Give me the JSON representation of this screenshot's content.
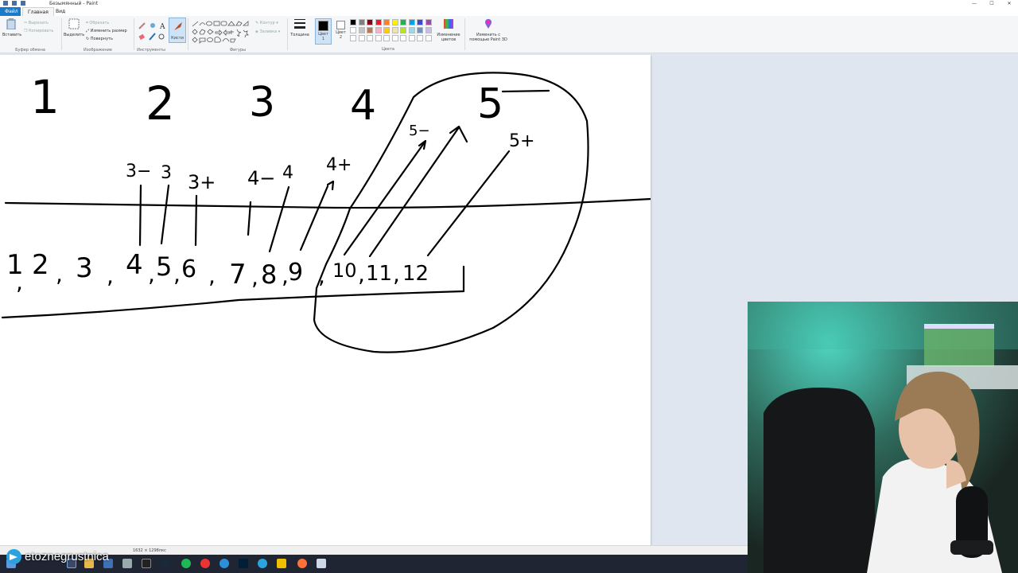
{
  "window": {
    "title": "Безымянный - Paint",
    "controls": [
      "—",
      "☐",
      "✕"
    ]
  },
  "tabs": {
    "file": "Файл",
    "home": "Главная",
    "view": "Вид"
  },
  "ribbon": {
    "clipboard": {
      "paste": "Вставить",
      "cut": "Вырезать",
      "copy": "Копировать",
      "label": "Буфер обмена"
    },
    "image": {
      "select": "Выделить",
      "crop": "Обрезать",
      "resize": "Изменить размер",
      "rotate": "Повернуть",
      "label": "Изображение"
    },
    "tools": {
      "label": "Инструменты"
    },
    "brushes": {
      "label": "Кисти"
    },
    "shapes": {
      "outline": "Контур",
      "fill": "Заливка",
      "label": "Фигуры"
    },
    "size": {
      "label": "Толщина"
    },
    "color1": {
      "label": "Цвет",
      "num": "1"
    },
    "color2": {
      "label": "Цвет",
      "num": "2"
    },
    "colors": {
      "label": "Цвета",
      "edit": "Изменение цветов",
      "palette": [
        "#000000",
        "#7f7f7f",
        "#880015",
        "#ed1c24",
        "#ff7f27",
        "#fff200",
        "#22b14c",
        "#00a2e8",
        "#3f48cc",
        "#a349a4",
        "#ffffff",
        "#c3c3c3",
        "#b97a57",
        "#ffaec9",
        "#ffc90e",
        "#efe4b0",
        "#b5e61d",
        "#99d9ea",
        "#7092be",
        "#c8bfe7"
      ]
    },
    "paint3d": {
      "label": "Изменить с помощью Paint 3D"
    }
  },
  "canvas_text": {
    "grades": [
      "1",
      "2",
      "3",
      "4",
      "5"
    ],
    "sub_grades": [
      "3−",
      "3",
      "3+",
      "4−",
      "4",
      "4+",
      "5−",
      "5+"
    ],
    "scale": [
      "1",
      "2",
      "3",
      "4",
      "5",
      "6",
      "7",
      "8",
      "9",
      "10",
      "11",
      "12"
    ]
  },
  "status": {
    "dimensions": "1632 × 1298пкс"
  },
  "overlay": {
    "channel": "etoznegrustnica"
  }
}
